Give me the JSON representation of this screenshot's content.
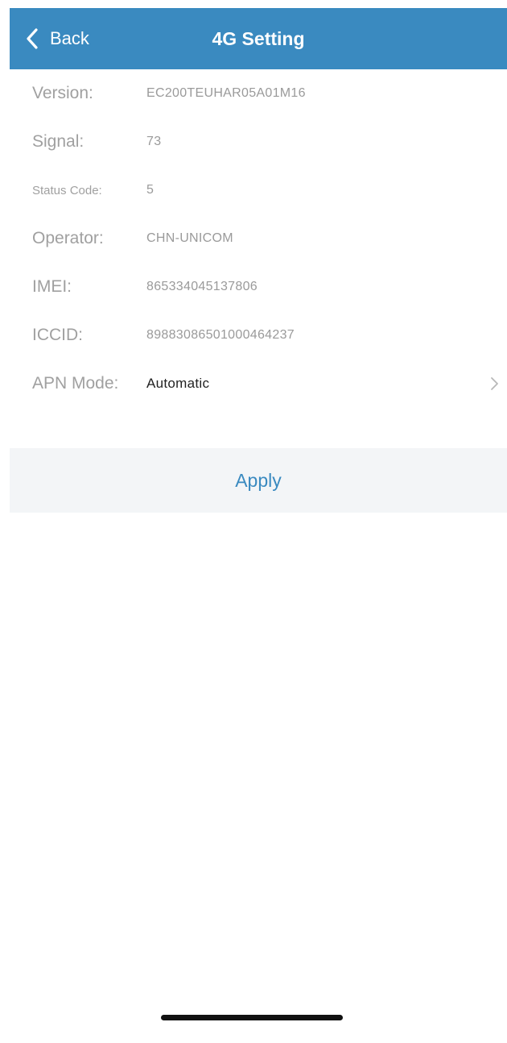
{
  "header": {
    "back_label": "Back",
    "title": "4G Setting"
  },
  "info": {
    "version": {
      "label": "Version:",
      "value": "EC200TEUHAR05A01M16"
    },
    "signal": {
      "label": "Signal:",
      "value": "73"
    },
    "status_code": {
      "label": "Status Code:",
      "value": "5"
    },
    "operator": {
      "label": "Operator:",
      "value": "CHN-UNICOM"
    },
    "imei": {
      "label": "IMEI:",
      "value": "865334045137806"
    },
    "iccid": {
      "label": "ICCID:",
      "value": "89883086501000464237"
    },
    "apn_mode": {
      "label": "APN Mode:",
      "value": "Automatic"
    }
  },
  "actions": {
    "apply_label": "Apply"
  },
  "colors": {
    "accent": "#3a8ac0",
    "navbar_bg": "#3a8ac0",
    "apply_bg": "#f3f5f7"
  },
  "icons": {
    "back": "chevron-left-icon",
    "apn": "chevron-right-icon"
  }
}
